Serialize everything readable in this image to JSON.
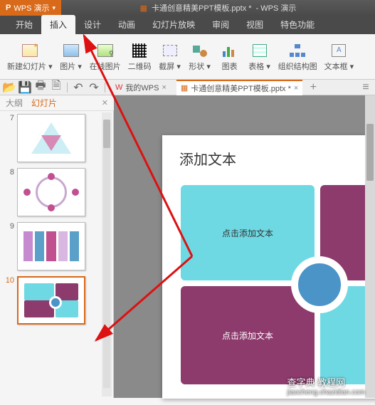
{
  "app": {
    "name": "WPS 演示",
    "title_doc": "卡通创意精美PPT模板.pptx *",
    "title_suffix": "- WPS 演示"
  },
  "menu": {
    "tabs": [
      "开始",
      "插入",
      "设计",
      "动画",
      "幻灯片放映",
      "审阅",
      "视图",
      "特色功能"
    ],
    "active_index": 1
  },
  "ribbon": {
    "items": [
      {
        "label": "新建幻灯片",
        "icon": "newslide",
        "dd": true
      },
      {
        "label": "图片",
        "icon": "image",
        "dd": true
      },
      {
        "label": "在线图片",
        "icon": "onlineimg"
      },
      {
        "label": "二维码",
        "icon": "qr"
      },
      {
        "label": "截屏",
        "icon": "screenshot",
        "dd": true
      },
      {
        "label": "形状",
        "icon": "shapes",
        "dd": true
      },
      {
        "label": "图表",
        "icon": "chart"
      },
      {
        "label": "表格",
        "icon": "table",
        "dd": true
      },
      {
        "label": "组织结构图",
        "icon": "org"
      },
      {
        "label": "文本框",
        "icon": "textbox",
        "dd": true
      }
    ]
  },
  "qat": {
    "my_wps": "我的WPS",
    "doc_tab": "卡通创意精美PPT模板.pptx *"
  },
  "panel": {
    "tabs": [
      "大纲",
      "幻灯片"
    ],
    "active_index": 1
  },
  "thumbs": [
    {
      "num": "7",
      "kind": "tri"
    },
    {
      "num": "8",
      "kind": "circle"
    },
    {
      "num": "9",
      "kind": "bars"
    },
    {
      "num": "10",
      "kind": "quad",
      "selected": true
    }
  ],
  "slide": {
    "title": "添加文本",
    "quad_tl": "点击添加文本",
    "quad_bl": "点击添加文本"
  },
  "watermark": {
    "main": "查字典 教程网",
    "sub": "jiaocheng.chazidian.com"
  }
}
